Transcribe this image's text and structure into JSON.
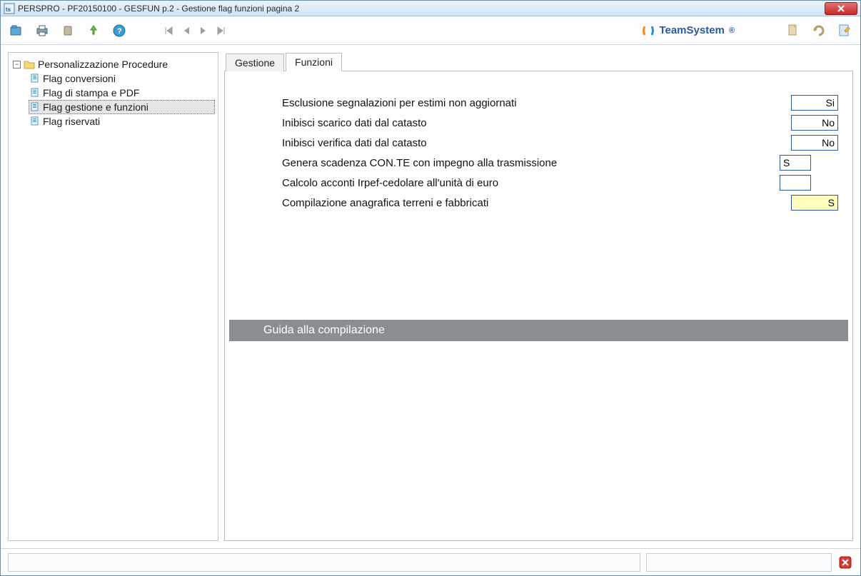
{
  "window": {
    "title": "PERSPRO  - PF20150100 -  GESFUN p.2 - Gestione flag funzioni pagina 2"
  },
  "toolbar": {
    "logo_text": "TeamSystem",
    "logo_reg": "®"
  },
  "tree": {
    "root_label": "Personalizzazione Procedure",
    "items": [
      {
        "label": "Flag conversioni"
      },
      {
        "label": "Flag di stampa e PDF"
      },
      {
        "label": "Flag gestione e funzioni"
      },
      {
        "label": "Flag riservati"
      }
    ]
  },
  "tabs": {
    "gestione": "Gestione",
    "funzioni": "Funzioni"
  },
  "form": {
    "rows": [
      {
        "label": "Esclusione segnalazioni per estimi non aggiornati",
        "value": "Si",
        "type": "wide"
      },
      {
        "label": "Inibisci scarico dati dal catasto",
        "value": "No",
        "type": "wide"
      },
      {
        "label": "Inibisci verifica dati dal catasto",
        "value": "No",
        "type": "wide"
      },
      {
        "label": "Genera scadenza CON.TE con impegno alla trasmissione",
        "value": "S",
        "type": "short"
      },
      {
        "label": "Calcolo acconti Irpef-cedolare all'unità di euro",
        "value": "",
        "type": "short"
      },
      {
        "label": "Compilazione anagrafica terreni e fabbricati",
        "value": "S",
        "type": "active"
      }
    ]
  },
  "guide": {
    "title": "Guida alla compilazione"
  }
}
